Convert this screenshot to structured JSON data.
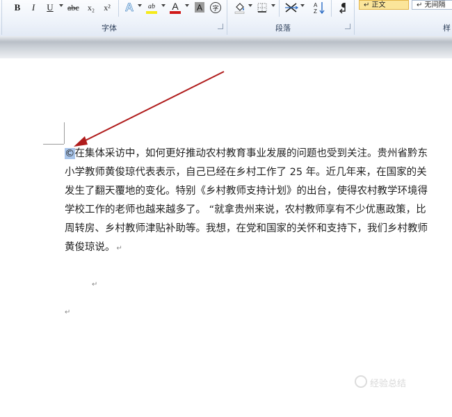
{
  "ribbon": {
    "font_group": {
      "label": "字体",
      "bold": "B",
      "italic": "I",
      "underline": "U",
      "strikethrough": "abc",
      "subscript": "x₂",
      "superscript": "x²",
      "text_effects": "A",
      "highlight": "ab",
      "font_color": "A",
      "char_shading": "A",
      "enclose": "字"
    },
    "paragraph_group": {
      "label": "段落"
    },
    "styles_group": {
      "label": "样",
      "style_normal": "↵ 正文",
      "style_no_spacing": "↵ 无间隔"
    }
  },
  "document": {
    "lines": [
      {
        "selected_char": "©",
        "text": "在集体采访中，如何更好推动农村教育事业发展的问题也受到关注。贵州省黔东"
      },
      {
        "text": "小学教师黄俊琼代表表示，自己已经在乡村工作了 25 年。近几年来，在国家的关"
      },
      {
        "text": "发生了翻天覆地的变化。特别《乡村教师支持计划》的出台，使得农村教学环境得"
      },
      {
        "text": "学校工作的老师也越来越多了。 “就拿贵州来说，农村教师享有不少优惠政策，比"
      },
      {
        "text": "周转房、乡村教师津贴补助等。我想，在党和国家的关怀和支持下，我们乡村教师"
      },
      {
        "text": "黄俊琼说。",
        "paragraph_mark": "↵"
      }
    ],
    "empty_marks": [
      "↵",
      "↵"
    ]
  },
  "annotation": {
    "arrow_color": "#b01c1c"
  },
  "watermark": {
    "text": "经验总结"
  }
}
